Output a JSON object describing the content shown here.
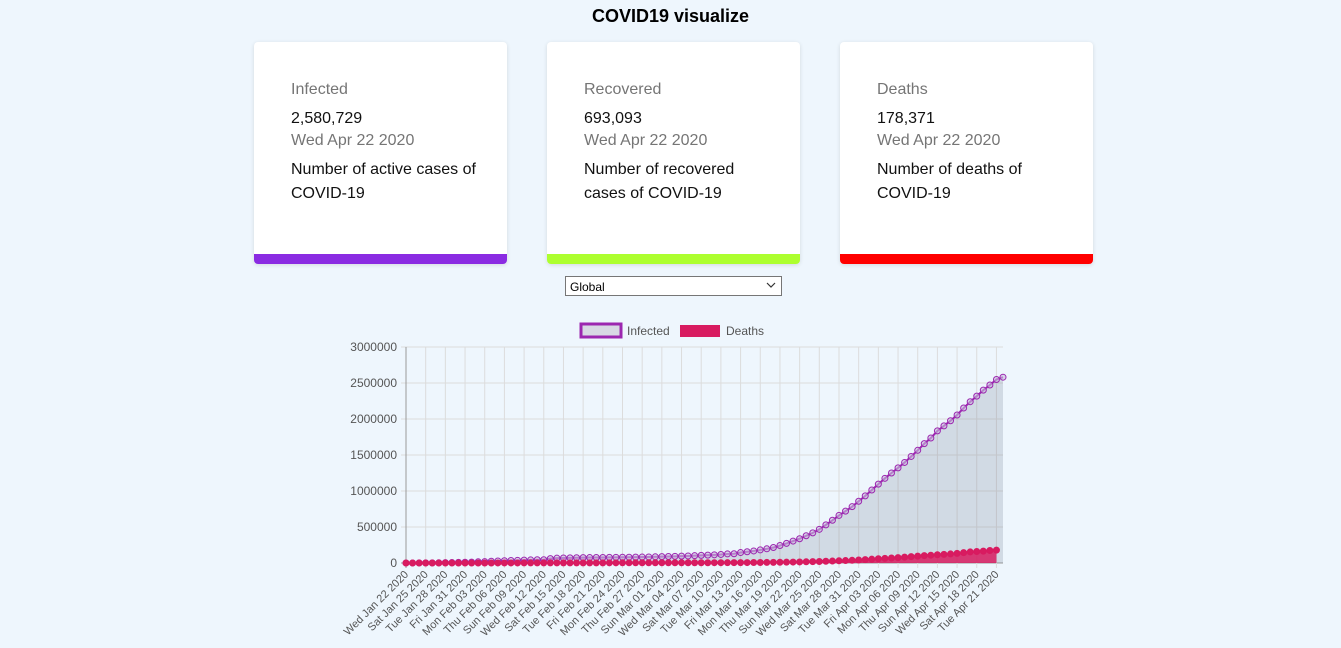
{
  "title": "COVID19 visualize",
  "cards": [
    {
      "title": "Infected",
      "value": "2,580,729",
      "date": "Wed Apr 22 2020",
      "desc": "Number of active cases of COVID-19",
      "color": "#8a2be2"
    },
    {
      "title": "Recovered",
      "value": "693,093",
      "date": "Wed Apr 22 2020",
      "desc": "Number of recovered cases of COVID-19",
      "color": "#adff2f"
    },
    {
      "title": "Deaths",
      "value": "178,371",
      "date": "Wed Apr 22 2020",
      "desc": "Number of deaths of COVID-19",
      "color": "#ff0000"
    }
  ],
  "country_select": {
    "selected": "Global",
    "icon": "chevron-down-icon"
  },
  "chart_data": {
    "type": "line",
    "legend_position": "top",
    "grid": true,
    "ylim": [
      0,
      3000000
    ],
    "y_ticks": [
      "3000000",
      "2500000",
      "2000000",
      "1500000",
      "1000000",
      "500000",
      "0"
    ],
    "x_tick_labels": [
      "Wed Jan 22 2020",
      "Sat Jan 25 2020",
      "Tue Jan 28 2020",
      "Fri Jan 31 2020",
      "Mon Feb 03 2020",
      "Thu Feb 06 2020",
      "Sun Feb 09 2020",
      "Wed Feb 12 2020",
      "Sat Feb 15 2020",
      "Tue Feb 18 2020",
      "Fri Feb 21 2020",
      "Mon Feb 24 2020",
      "Thu Feb 27 2020",
      "Sun Mar 01 2020",
      "Wed Mar 04 2020",
      "Sat Mar 07 2020",
      "Tue Mar 10 2020",
      "Fri Mar 13 2020",
      "Mon Mar 16 2020",
      "Thu Mar 19 2020",
      "Sun Mar 22 2020",
      "Wed Mar 25 2020",
      "Sat Mar 28 2020",
      "Tue Mar 31 2020",
      "Fri Apr 03 2020",
      "Mon Apr 06 2020",
      "Thu Apr 09 2020",
      "Sun Apr 12 2020",
      "Wed Apr 15 2020",
      "Sat Apr 18 2020",
      "Tue Apr 21 2020"
    ],
    "x_start": "2020-01-22",
    "x_end": "2020-04-22",
    "series": [
      {
        "name": "Infected",
        "color": "#9c27b0",
        "fill": "rgba(110,120,140,0.22)",
        "values": [
          555,
          654,
          941,
          1434,
          2118,
          2927,
          5578,
          6166,
          8234,
          9927,
          12038,
          16787,
          19881,
          23892,
          27635,
          30794,
          34391,
          37120,
          40150,
          42762,
          44802,
          45221,
          60368,
          66885,
          69030,
          71224,
          73258,
          75136,
          75639,
          76197,
          76819,
          78572,
          78958,
          79561,
          80406,
          81388,
          82746,
          84112,
          86011,
          88369,
          90306,
          92840,
          95120,
          97886,
          101800,
          105847,
          109821,
          113590,
          118620,
          125875,
          128352,
          145205,
          156101,
          167454,
          181574,
          197102,
          214821,
          242570,
          272208,
          304507,
          336953,
          378235,
          418045,
          467653,
          529591,
          593291,
          660693,
          720140,
          782389,
          857487,
          932605,
          1013466,
          1095917,
          1176060,
          1249754,
          1321481,
          1396476,
          1479804,
          1565278,
          1657526,
          1735650,
          1834721,
          1904838,
          1976191,
          2056054,
          2152437,
          2240190,
          2317758,
          2401378,
          2472259,
          2549123,
          2580729
        ]
      },
      {
        "name": "Deaths",
        "color": "#d81b60",
        "values": [
          17,
          18,
          26,
          42,
          56,
          82,
          131,
          133,
          171,
          213,
          259,
          362,
          426,
          492,
          564,
          634,
          719,
          806,
          906,
          1013,
          1113,
          1118,
          1371,
          1523,
          1666,
          1770,
          1868,
          2007,
          2122,
          2247,
          2251,
          2458,
          2469,
          2629,
          2708,
          2770,
          2814,
          2872,
          2941,
          2996,
          3085,
          3160,
          3254,
          3348,
          3460,
          3558,
          3803,
          3996,
          4262,
          4615,
          4720,
          5404,
          5819,
          6440,
          7126,
          7905,
          8733,
          9867,
          11299,
          12973,
          14651,
          16505,
          18625,
          21181,
          23970,
          27198,
          30652,
          33925,
          37582,
          42107,
          46809,
          52983,
          58787,
          64606,
          69374,
          74565,
          81865,
          88338,
          95455,
          102525,
          108503,
          114090,
          119482,
          125984,
          134177,
          143800,
          153822,
          159510,
          165044,
          173665,
          178371
        ]
      }
    ]
  }
}
